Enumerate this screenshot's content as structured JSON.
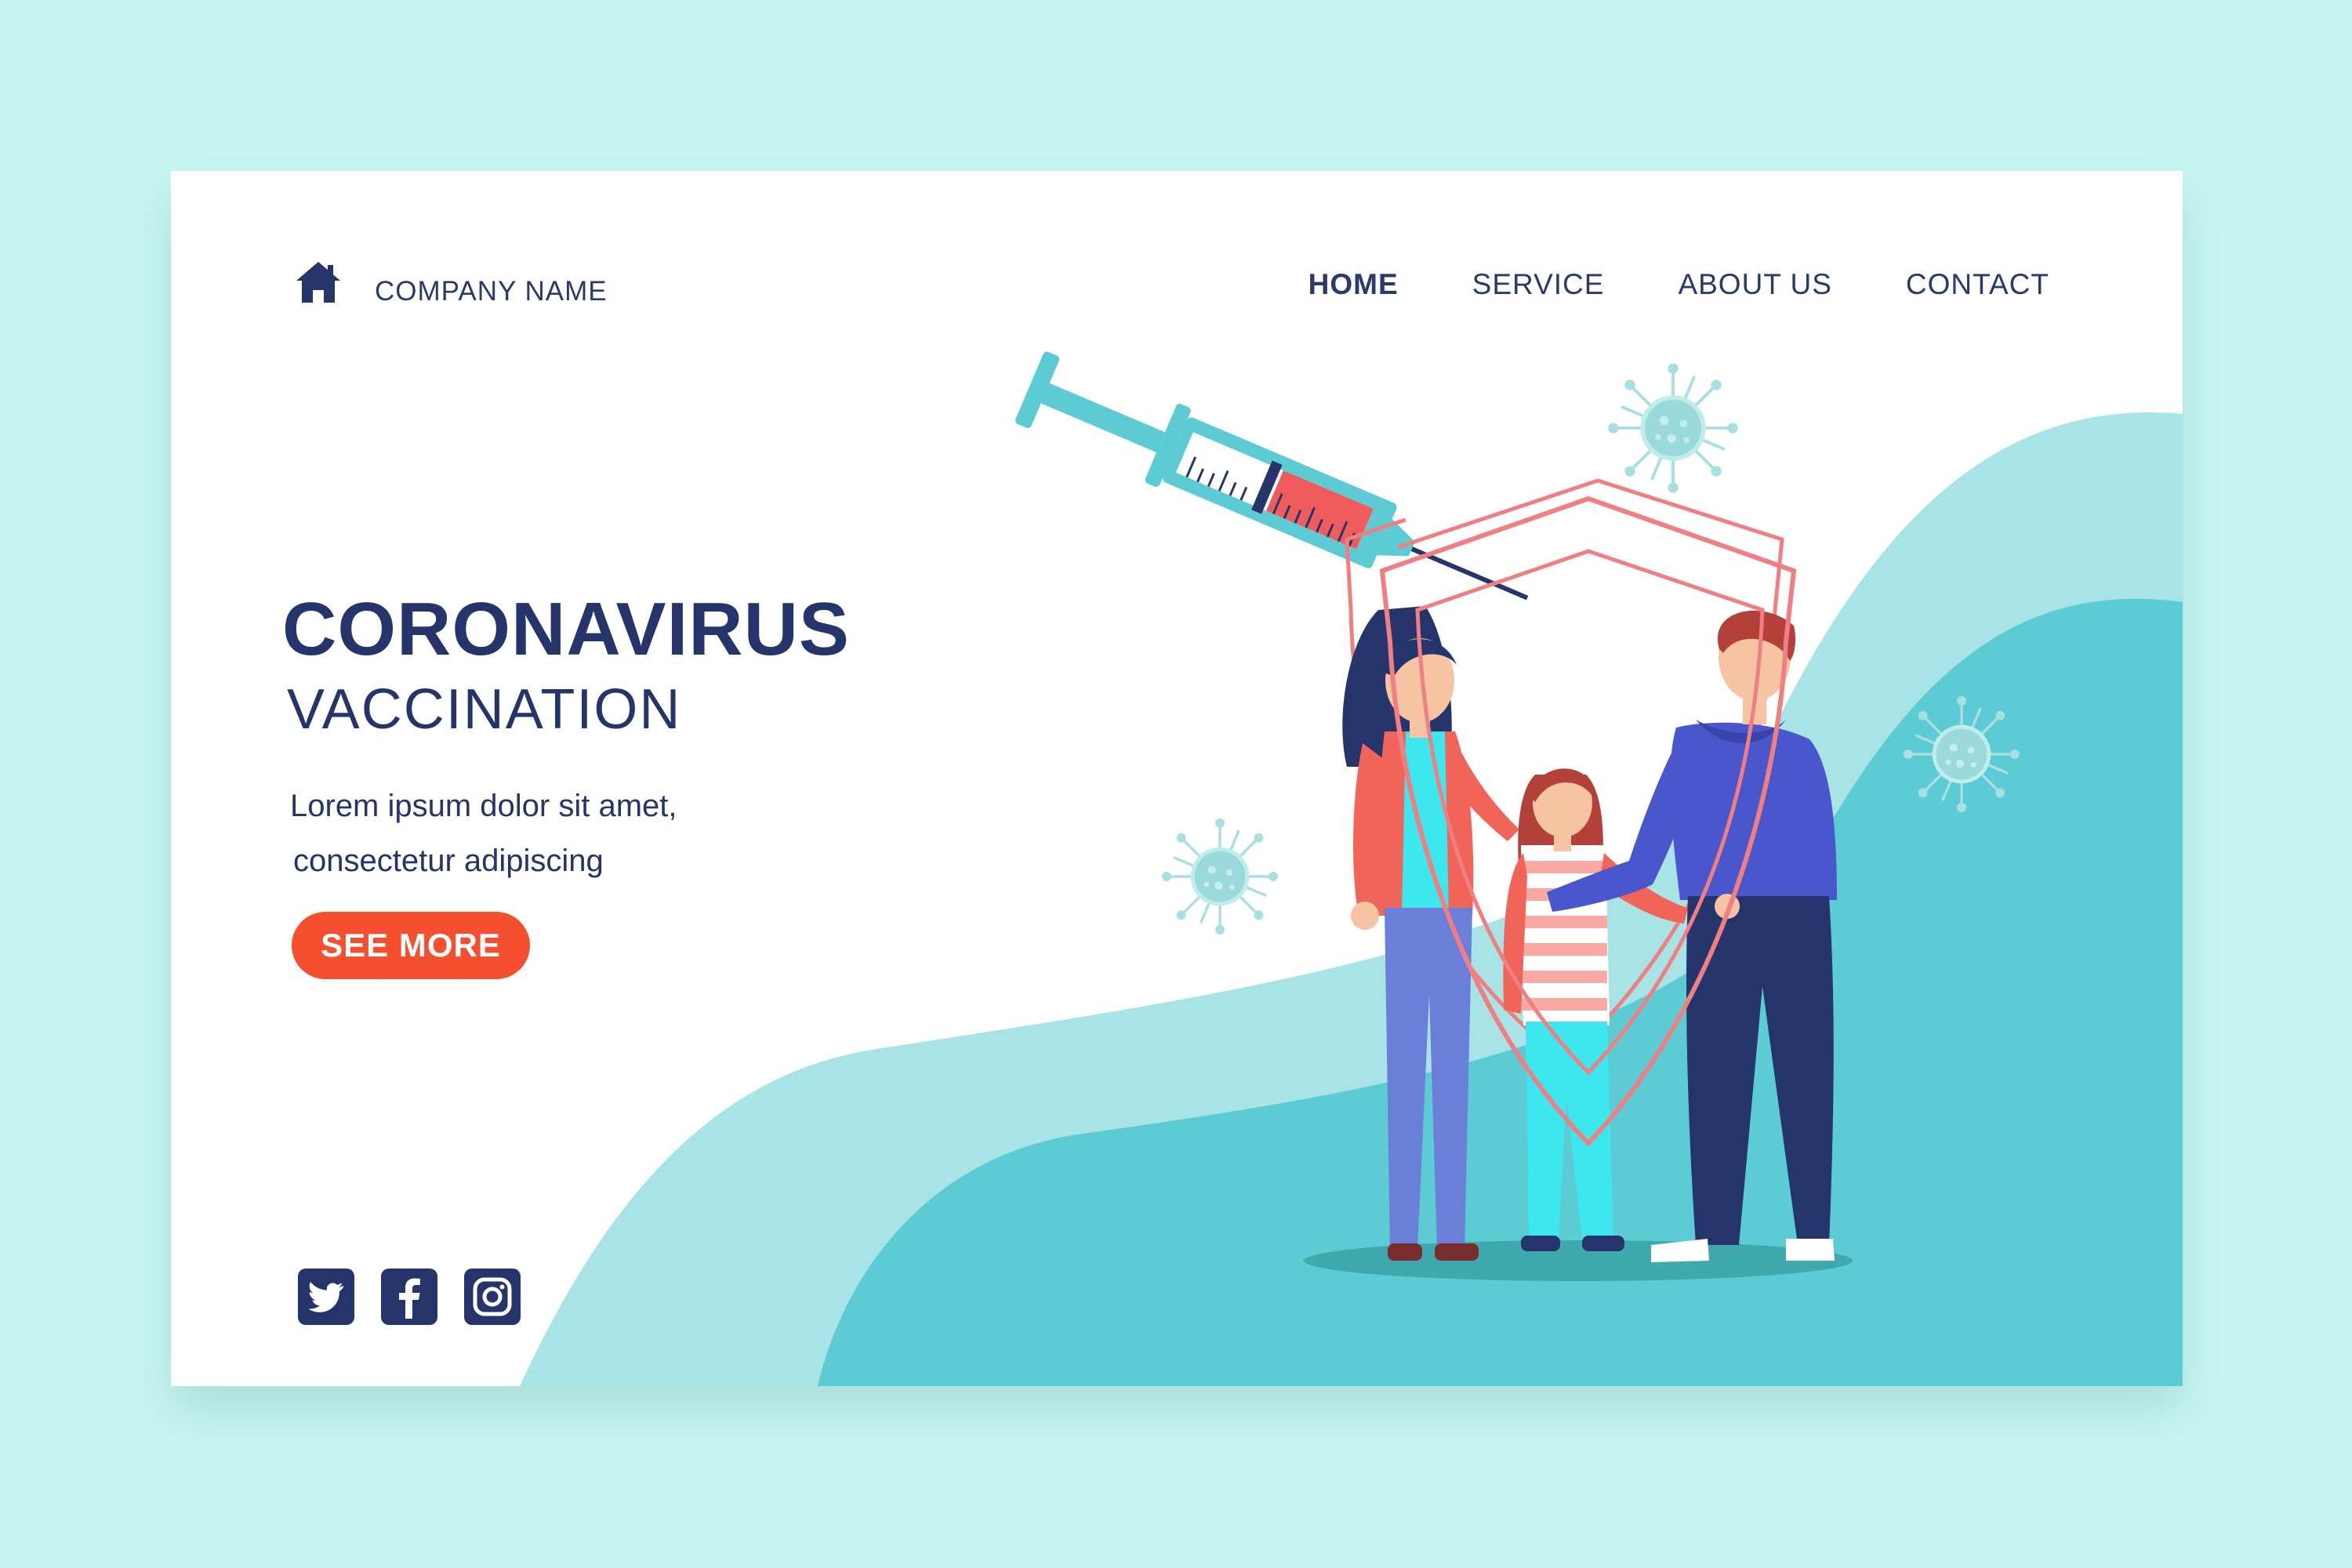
{
  "company": {
    "name": "COMPANY NAME",
    "logo_icon": "house-icon"
  },
  "nav": [
    {
      "label": "HOME",
      "active": true
    },
    {
      "label": "SERVICE",
      "active": false
    },
    {
      "label": "ABOUT US",
      "active": false
    },
    {
      "label": "CONTACT",
      "active": false
    }
  ],
  "hero": {
    "title": "CORONAVIRUS",
    "subtitle": "VACCINATION",
    "line1": "Lorem ipsum dolor sit amet,",
    "line2": "consectetur adipiscing",
    "cta_label": "SEE MORE"
  },
  "social": [
    {
      "name": "twitter-icon"
    },
    {
      "name": "facebook-icon"
    },
    {
      "name": "instagram-icon"
    }
  ],
  "colors": {
    "page_bg": "#c9f6f1",
    "navy": "#25346a",
    "cta": "#f44f2f",
    "teal_light": "#a8e4e6",
    "teal_dark": "#5ccbd3",
    "shield": "#f07f83"
  }
}
